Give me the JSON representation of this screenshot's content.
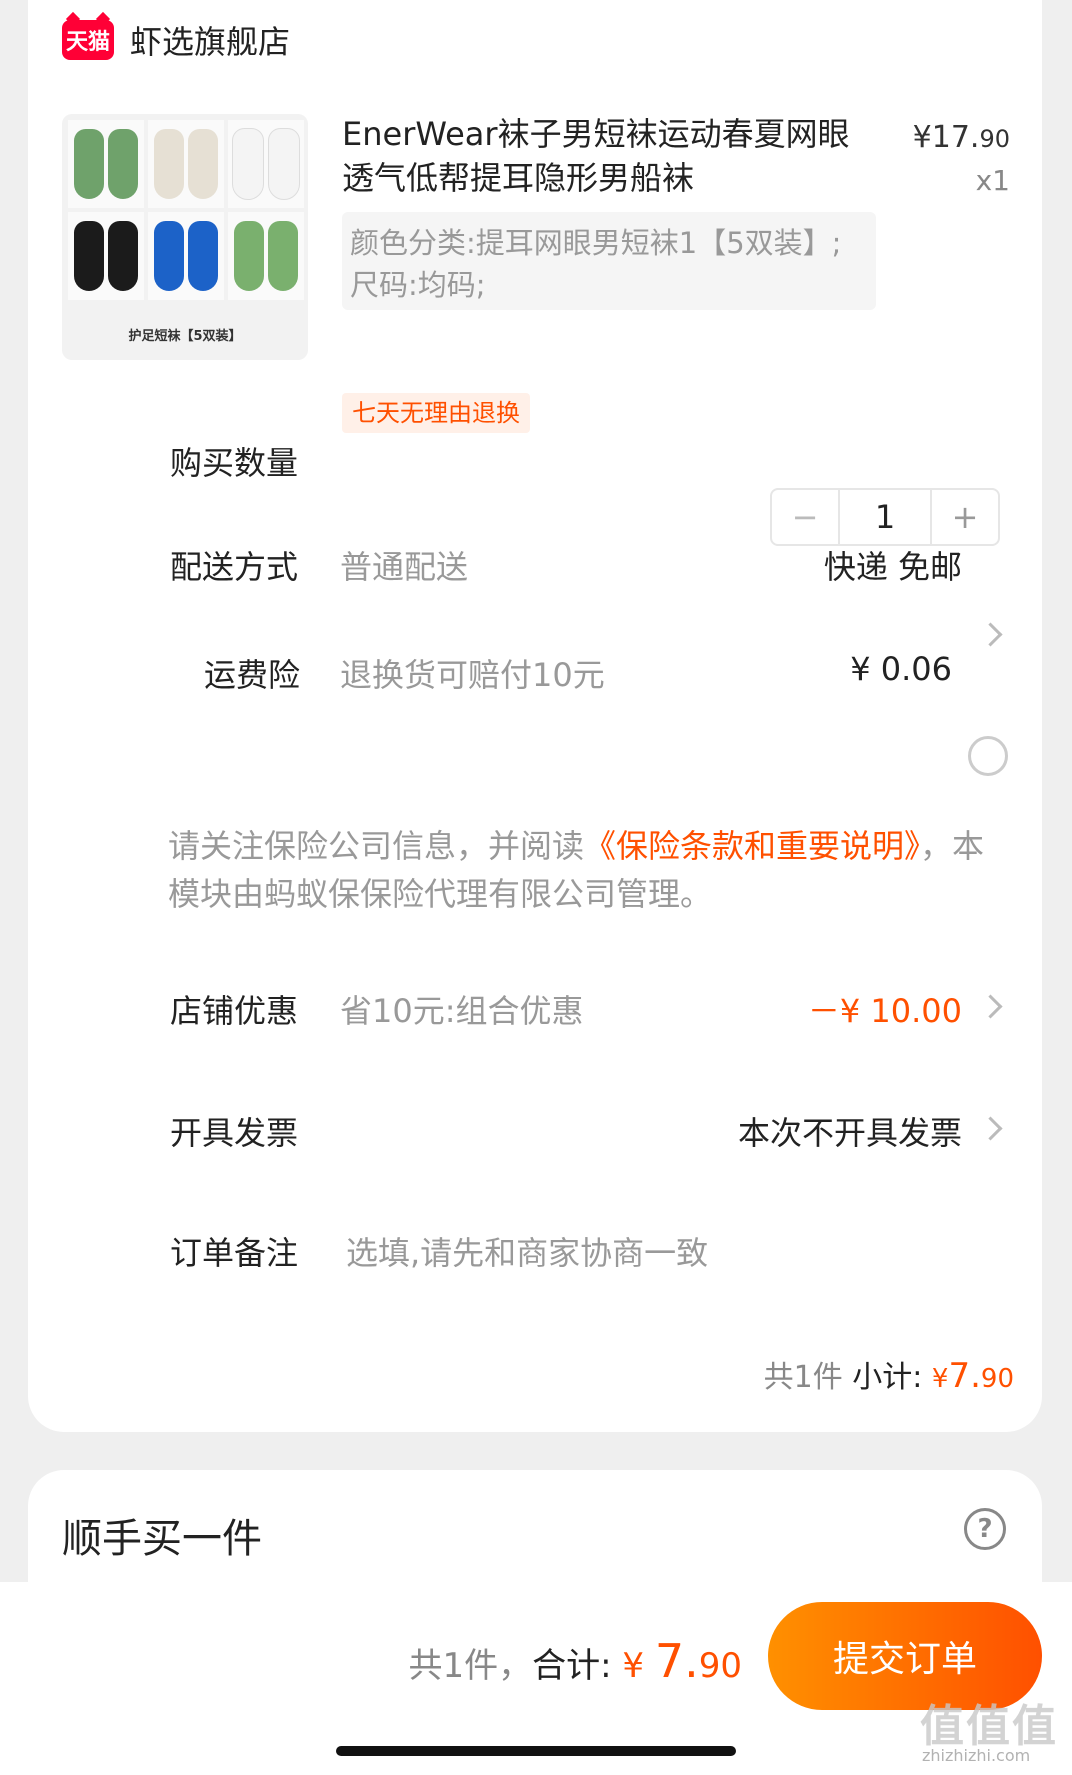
{
  "shop": {
    "badge": "天猫",
    "name": "虾选旗舰店"
  },
  "product": {
    "title": "EnerWear袜子男短袜运动春夏网眼透气低帮提耳隐形男船袜",
    "price_main": "¥17.",
    "price_cents": "90",
    "quantity_label": "x1",
    "sku": "颜色分类:提耳网眼男短袜1【5双装】;尺码:均码;",
    "image_caption": "护足短袜【5双装】",
    "tag": "七天无理由退换",
    "sock_colors": [
      "#6fa26b",
      "#e6e0d4",
      "#f4f4f4",
      "#1b1b1b",
      "#1c62c8",
      "#7ab06e"
    ]
  },
  "quantity": {
    "label": "购买数量",
    "minus": "−",
    "value": "1",
    "plus": "+"
  },
  "shipping": {
    "label": "配送方式",
    "sub": "普通配送",
    "value": "快递 免邮"
  },
  "insurance": {
    "label": "运费险",
    "sub": "退换货可赔付10元",
    "price": "¥ 0.06",
    "notice_pre": "请关注保险公司信息，并阅读",
    "notice_link": "《保险条款和重要说明》",
    "notice_post": "，本模块由蚂蚁保保险代理有限公司管理。"
  },
  "discount": {
    "label": "店铺优惠",
    "sub": "省10元:组合优惠",
    "value": "－¥ 10.00"
  },
  "invoice": {
    "label": "开具发票",
    "value": "本次不开具发票"
  },
  "remark": {
    "label": "订单备注",
    "placeholder": "选填,请先和商家协商一致"
  },
  "subtotal": {
    "count": "共1件",
    "label": " 小计: ",
    "currency": "¥",
    "amount": "7.",
    "cents": "90"
  },
  "extra": {
    "title": "顺手买一件",
    "help": "?"
  },
  "footer": {
    "count": "共1件，",
    "label": "合计: ",
    "currency": "¥ ",
    "amount": "7.",
    "cents": "90",
    "submit": "提交订单"
  },
  "watermark": {
    "main": "值值值",
    "sub": "zhizhizhi.com"
  }
}
